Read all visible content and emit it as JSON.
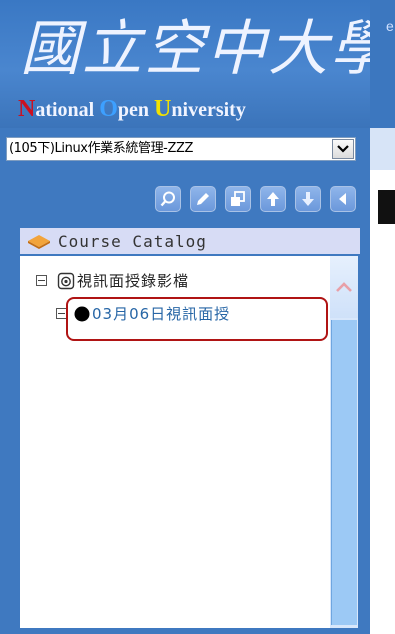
{
  "header": {
    "logo_chinese": "國立空中大學",
    "logo_english": {
      "n_cap": "N",
      "n_rest": "ational ",
      "o_cap": "O",
      "o_rest": "pen ",
      "u_cap": "U",
      "u_rest": "niversity"
    },
    "right_edge_letter": "e"
  },
  "course_select": {
    "selected": "(105下)Linux作業系統管理-ZZZ"
  },
  "toolbar": {
    "buttons": [
      {
        "icon": "search-icon"
      },
      {
        "icon": "pencil-icon"
      },
      {
        "icon": "copy-icon"
      },
      {
        "icon": "arrow-up-icon"
      },
      {
        "icon": "arrow-down-icon"
      },
      {
        "icon": "collapse-left-icon"
      }
    ]
  },
  "catalog": {
    "title": "Course Catalog",
    "tree": [
      {
        "label": "視訊面授錄影檔",
        "icon": "camera-icon"
      },
      {
        "label": "03月06日視訊面授",
        "icon": "bullet-icon",
        "selected": true
      }
    ]
  },
  "colors": {
    "panel": "#3f79c0",
    "catalog_title_bg": "#d7dcf5",
    "selected_text": "#2766a6",
    "highlight": "#b01414"
  }
}
